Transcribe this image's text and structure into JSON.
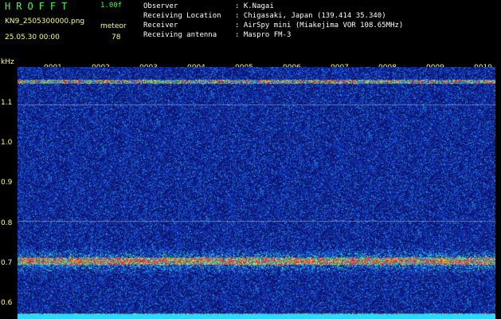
{
  "header": {
    "app_title": "HROFFT",
    "version": "1.00f",
    "filename": "KN9_2505300000.png",
    "meteor_label": "meteor",
    "timestamp": "25.05.30 00:00",
    "meteor_count": "78",
    "info": [
      {
        "label": "Observer",
        "value": ": K.Nagai"
      },
      {
        "label": "Receiving Location",
        "value": ": Chigasaki, Japan (139.414 35.340)"
      },
      {
        "label": "Receiver",
        "value": ": AirSpy mini (Miakejima VOR 108.65MHz)"
      },
      {
        "label": "Receiving antenna",
        "value": ": Maspro FM-3"
      }
    ]
  },
  "axis": {
    "y_unit": "kHz",
    "y_ticks": [
      "1.1",
      "1.0",
      "0.9",
      "0.8",
      "0.7",
      "0.6"
    ],
    "x_ticks": [
      "0001",
      "0002",
      "0003",
      "0004",
      "0005",
      "0006",
      "0007",
      "0008",
      "0009",
      "0010"
    ]
  },
  "colors": {
    "background": "#000000",
    "label_green": "#3cff3c",
    "label_yellow": "#ffff64",
    "spectrum_base": "#0a1a7a",
    "spectrum_strong": "#ff2a2a"
  }
}
